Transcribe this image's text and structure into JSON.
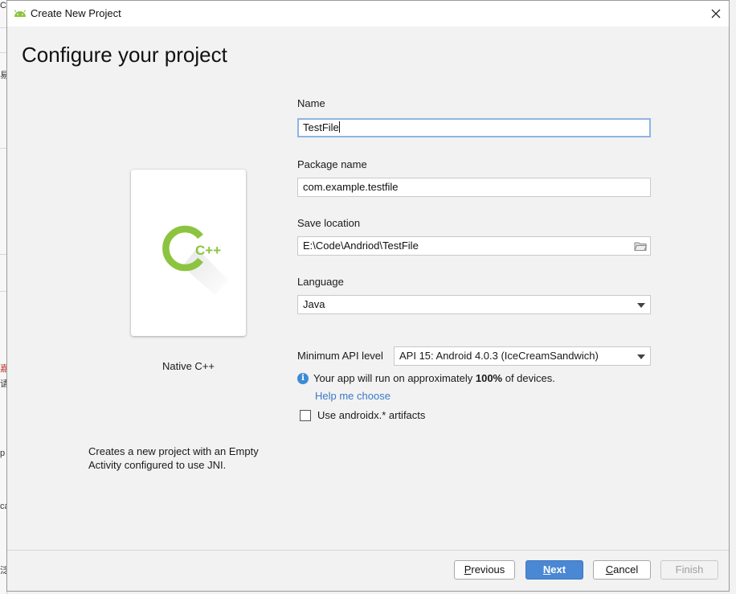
{
  "window": {
    "title": "Create New Project",
    "close_icon": "close-icon"
  },
  "background_strip": {
    "marks": [
      "C",
      "易",
      "嘉",
      "请",
      "p",
      "ca",
      "泛"
    ]
  },
  "page": {
    "heading": "Configure your project"
  },
  "template": {
    "name": "Native C++",
    "description": "Creates a new project with an Empty Activity configured to use JNI.",
    "logo_text": "C++",
    "logo_color": "#8cc43f"
  },
  "form": {
    "name": {
      "label": "Name",
      "value": "TestFile"
    },
    "package": {
      "label": "Package name",
      "value": "com.example.testfile"
    },
    "save_location": {
      "label": "Save location",
      "value": "E:\\Code\\Andriod\\TestFile",
      "icon": "folder-icon"
    },
    "language": {
      "label": "Language",
      "value": "Java"
    },
    "min_api": {
      "label": "Minimum API level",
      "value": "API 15: Android 4.0.3 (IceCreamSandwich)"
    },
    "info": {
      "prefix": "Your app will run on approximately ",
      "percent": "100%",
      "suffix": " of devices.",
      "icon": "info-icon"
    },
    "help_link": "Help me choose",
    "androidx_checkbox": {
      "label": "Use androidx.* artifacts",
      "checked": false
    }
  },
  "buttons": {
    "previous": {
      "mnemonic": "P",
      "rest": "revious"
    },
    "next": {
      "mnemonic": "N",
      "rest": "ext"
    },
    "cancel": {
      "mnemonic": "C",
      "rest": "ancel"
    },
    "finish": {
      "label": "Finish"
    }
  },
  "colors": {
    "accent": "#4a88d4",
    "link": "#3a79c9",
    "focus_border": "#8fb3e6",
    "info": "#3d8bd6"
  }
}
